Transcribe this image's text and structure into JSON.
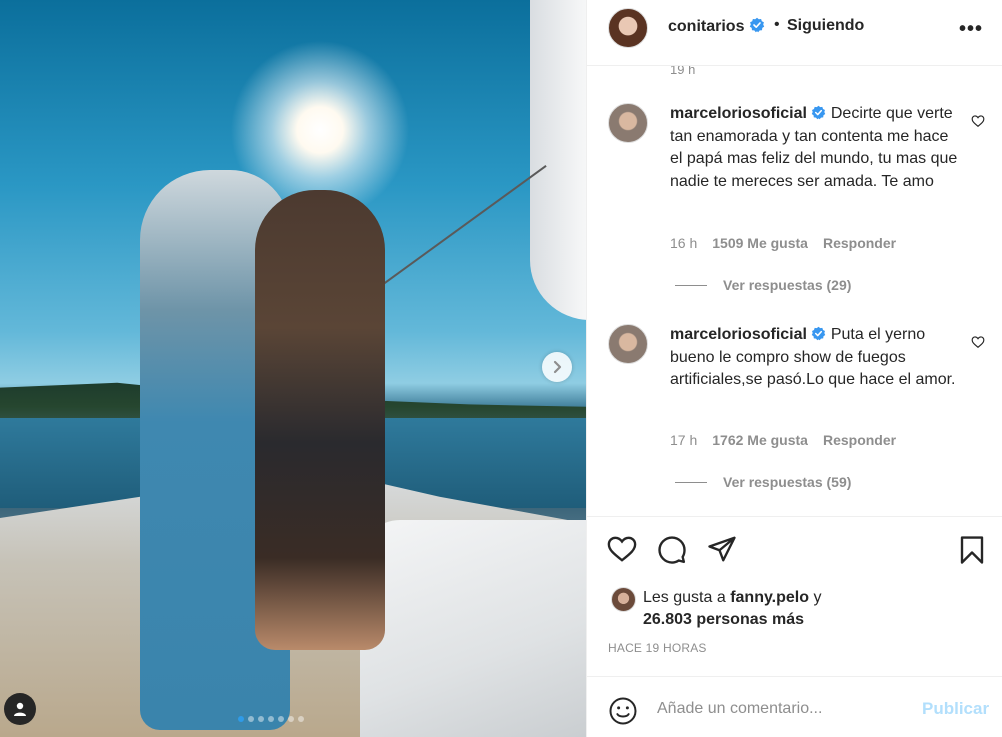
{
  "header": {
    "username": "conitarios",
    "separator": "•",
    "follow_status": "Siguiendo",
    "more_label": "•••"
  },
  "comments_cut_text": "19 h",
  "comments": [
    {
      "username": "marceloriosoficial",
      "text": "Decirte que verte tan enamorada y tan contenta me hace el papá mas feliz del mundo, tu mas que nadie te mereces ser amada. Te amo",
      "time": "16 h",
      "likes": "1509 Me gusta",
      "reply": "Responder",
      "view_replies": "Ver respuestas (29)"
    },
    {
      "username": "marceloriosoficial",
      "text": "Puta el yerno bueno le compro show de fuegos artificiales,se pasó.Lo que hace el amor.",
      "time": "17 h",
      "likes": "1762 Me gusta",
      "reply": "Responder",
      "view_replies": "Ver respuestas (59)"
    }
  ],
  "likes": {
    "prefix": "Les gusta a",
    "user": "fanny.pelo",
    "suffix": "y",
    "count": "26.803 personas más"
  },
  "timestamp": "HACE 19 HORAS",
  "add_comment": {
    "placeholder": "Añade un comentario...",
    "publish": "Publicar"
  },
  "carousel": {
    "total": 7,
    "active": 1
  },
  "colors": {
    "verified": "#3897f0",
    "publish_disabled": "#b2dffc",
    "active_dot": "#2f9be8",
    "text_primary": "#262626",
    "text_secondary": "#8e8e8e"
  },
  "icons": [
    "chevron-right-icon",
    "user-tag-icon",
    "verified-badge-icon",
    "heart-icon",
    "comment-icon",
    "share-icon",
    "bookmark-icon",
    "emoji-icon",
    "more-icon"
  ]
}
